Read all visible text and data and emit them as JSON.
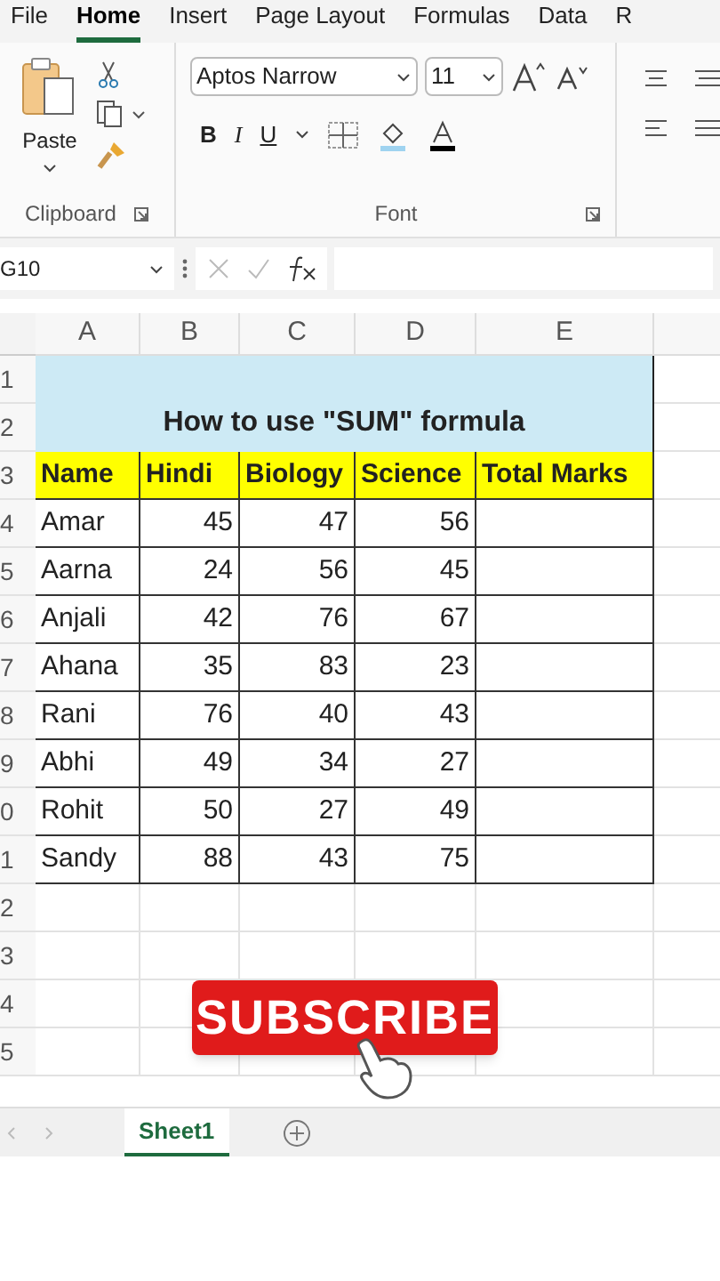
{
  "menu_tabs": [
    {
      "label": "File",
      "selected": false
    },
    {
      "label": "Home",
      "selected": true
    },
    {
      "label": "Insert",
      "selected": false
    },
    {
      "label": "Page Layout",
      "selected": false
    },
    {
      "label": "Formulas",
      "selected": false
    },
    {
      "label": "Data",
      "selected": false
    },
    {
      "label": "R",
      "selected": false
    }
  ],
  "ribbon": {
    "paste_label": "Paste",
    "clipboard_group": "Clipboard",
    "font_name": "Aptos Narrow",
    "font_size": "11",
    "font_group": "Font",
    "bold": "B",
    "italic": "I",
    "underline": "U"
  },
  "name_box": "G10",
  "columns": [
    "A",
    "B",
    "C",
    "D",
    "E"
  ],
  "row_numbers": [
    "1",
    "2",
    "3",
    "4",
    "5",
    "6",
    "7",
    "8",
    "9",
    "0",
    "1",
    "2",
    "3",
    "4",
    "5"
  ],
  "title": "How to use \"SUM\" formula",
  "headers": [
    "Name",
    "Hindi",
    "Biology",
    "Science",
    "Total Marks"
  ],
  "rows": [
    [
      "Amar",
      "45",
      "47",
      "56"
    ],
    [
      "Aarna",
      "24",
      "56",
      "45"
    ],
    [
      "Anjali",
      "42",
      "76",
      "67"
    ],
    [
      "Ahana",
      "35",
      "83",
      "23"
    ],
    [
      "Rani",
      "76",
      "40",
      "43"
    ],
    [
      "Abhi",
      "49",
      "34",
      "27"
    ],
    [
      "Rohit",
      "50",
      "27",
      "49"
    ],
    [
      "Sandy",
      "88",
      "43",
      "75"
    ]
  ],
  "sheet_tabs": [
    {
      "label": "Sheet1",
      "selected": true
    }
  ],
  "sticker": "SUBSCRIBE"
}
